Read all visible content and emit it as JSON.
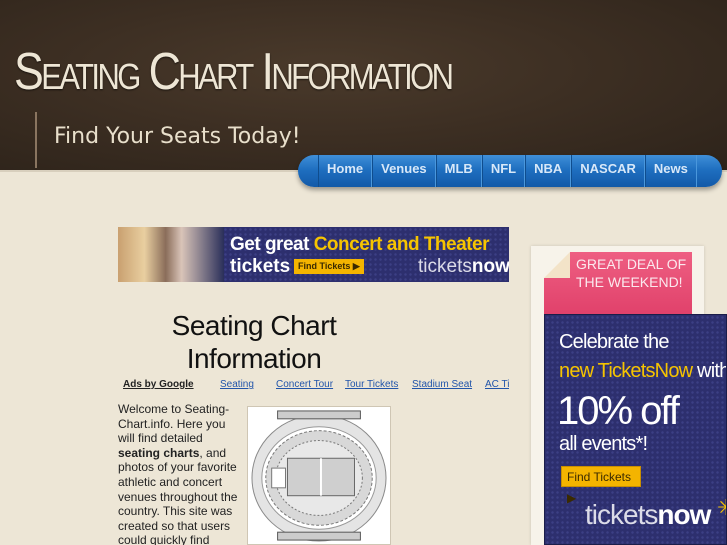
{
  "header": {
    "site_title": "Seating Chart Information",
    "tagline": "Find Your Seats Today!"
  },
  "nav": {
    "items": [
      {
        "label": "Home"
      },
      {
        "label": "Venues"
      },
      {
        "label": "MLB"
      },
      {
        "label": "NFL"
      },
      {
        "label": "NBA"
      },
      {
        "label": "NASCAR"
      },
      {
        "label": "News"
      }
    ]
  },
  "banner_ad": {
    "line1_a": "Get great ",
    "line1_b": "Concert and Theater",
    "line2": "tickets",
    "button": "Find Tickets ▶",
    "logo_a": "tickets",
    "logo_b": "now"
  },
  "main": {
    "heading": "Seating Chart Information",
    "ads_label": "Ads by Google",
    "ad_links": [
      "Seating",
      "Concert Tour",
      "Tour Tickets",
      "Stadium Seat",
      "AC Ti"
    ],
    "intro_a": "Welcome to Seating-Chart.info.  Here you will find detailed ",
    "intro_bold": "seating charts",
    "intro_b": ", and photos of your favorite athletic and concert venues throughout the country.  This site was created so that users could quickly find"
  },
  "sidebar": {
    "deal_title": "GREAT DEAL OF THE WEEKEND!",
    "ad": {
      "line1": "Celebrate the",
      "line2_a": "new TicketsNow",
      "line2_b": " with",
      "line3": "10% off",
      "line4": "all events*!",
      "button": "Find Tickets ▶",
      "logo_a": "tickets",
      "logo_b": "now"
    }
  },
  "colors": {
    "header_bg": "#3d2f23",
    "nav_blue": "#1f6fc0",
    "page_bg": "#ede6d6",
    "ad_navy": "#2d2f6e",
    "ad_yellow": "#f6c400",
    "deal_pink": "#e84a72",
    "link_blue": "#2255aa"
  }
}
